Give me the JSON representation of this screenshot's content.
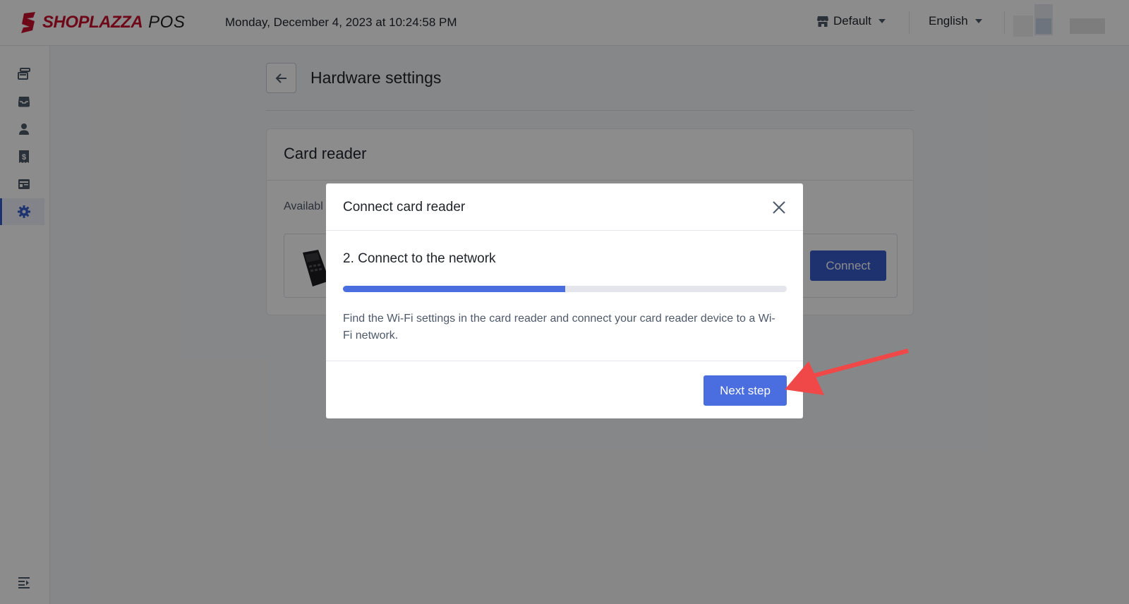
{
  "header": {
    "logo_text": "SHOPLAZZA",
    "logo_suffix": "POS",
    "datetime": "Monday, December 4, 2023 at 10:24:58 PM",
    "store_label": "Default",
    "language_label": "English"
  },
  "sidebar": {
    "items": [
      {
        "name": "orders",
        "icon": "cards-icon"
      },
      {
        "name": "inbox",
        "icon": "inbox-icon"
      },
      {
        "name": "customers",
        "icon": "person-icon"
      },
      {
        "name": "transactions",
        "icon": "receipt-dollar-icon"
      },
      {
        "name": "register",
        "icon": "register-icon"
      },
      {
        "name": "settings",
        "icon": "gear-icon",
        "active": true
      }
    ],
    "accent": "#3a5ccc"
  },
  "page": {
    "title": "Hardware settings",
    "card_title": "Card reader",
    "card_subtitle": "Availabl",
    "connect_label": "Connect"
  },
  "modal": {
    "title": "Connect card reader",
    "step_title": "2. Connect to the network",
    "progress_fraction": 0.5,
    "description": "Find the Wi-Fi settings in the card reader and connect your card reader device to a Wi-Fi network.",
    "next_label": "Next step",
    "primary_color": "#4a6ee0"
  },
  "annotation": {
    "color": "#f04848",
    "points_to": "next-step-button"
  }
}
